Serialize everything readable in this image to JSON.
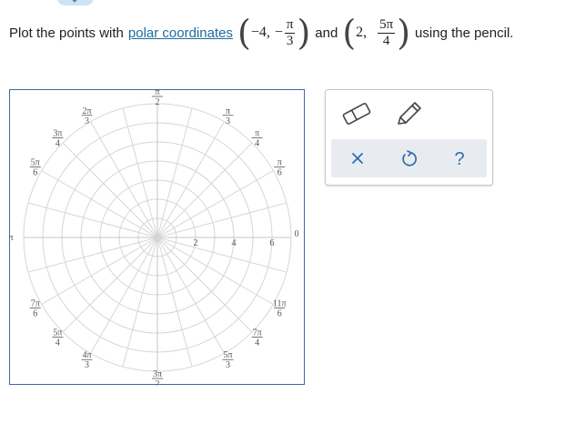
{
  "question": {
    "text_before": "Plot the points with",
    "link_text": "polar coordinates",
    "point1": {
      "r": "−4,",
      "theta_sign": "−",
      "theta_num": "π",
      "theta_den": "3"
    },
    "and_text": "and",
    "point2": {
      "r": "2,",
      "theta_num": "5π",
      "theta_den": "4"
    },
    "text_after": "using the pencil."
  },
  "polar_graph": {
    "radius_labels": [
      "2",
      "4",
      "6"
    ],
    "zero_label": "0",
    "angle_labels": {
      "pi_over_3": {
        "num": "π",
        "den": "3"
      },
      "pi_over_4": {
        "num": "π",
        "den": "4"
      },
      "pi_over_6": {
        "num": "π",
        "den": "6"
      },
      "pi_over_2": {
        "num": "π",
        "den": "2"
      },
      "two_pi_over_3": {
        "num": "2π",
        "den": "3"
      },
      "three_pi_over_4": {
        "num": "3π",
        "den": "4"
      },
      "five_pi_over_6": {
        "num": "5π",
        "den": "6"
      },
      "pi": {
        "num": "π",
        "den": ""
      },
      "seven_pi_over_6": {
        "num": "7π",
        "den": "6"
      },
      "five_pi_over_4": {
        "num": "5π",
        "den": "4"
      },
      "four_pi_over_3": {
        "num": "4π",
        "den": "3"
      },
      "three_pi_over_2": {
        "num": "3π",
        "den": "2"
      },
      "five_pi_over_3": {
        "num": "5π",
        "den": "3"
      },
      "seven_pi_over_4": {
        "num": "7π",
        "den": "4"
      },
      "eleven_pi_over_6": {
        "num": "11π",
        "den": "6"
      }
    },
    "ring_count": 7
  },
  "toolbar": {
    "eraser_icon": "eraser-icon",
    "pencil_icon": "pencil-icon",
    "clear_icon": "x-icon",
    "undo_icon": "undo-icon",
    "help_icon": "question-icon",
    "help_glyph": "?"
  },
  "colors": {
    "link": "#1f6b9e",
    "frame": "#3b6aa8",
    "grid": "#d6d6d6",
    "action_bar": "#e8ecf0",
    "icon_blue": "#2f6db0"
  }
}
